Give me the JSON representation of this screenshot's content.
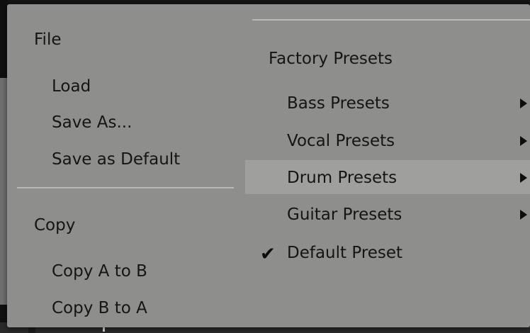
{
  "menu": {
    "left_column": {
      "file_header": "File",
      "file_items": [
        "Load",
        "Save As...",
        "Save as Default"
      ],
      "copy_header": "Copy",
      "copy_items": [
        "Copy A to B",
        "Copy B to A"
      ]
    },
    "right_column": {
      "factory_header": "Factory Presets",
      "presets": [
        {
          "label": "Bass Presets",
          "has_submenu": true
        },
        {
          "label": "Vocal Presets",
          "has_submenu": true
        },
        {
          "label": "Drum Presets",
          "has_submenu": true,
          "highlighted": true
        },
        {
          "label": "Guitar Presets",
          "has_submenu": true
        }
      ],
      "checked_item": {
        "label": "Default Preset",
        "checked": true,
        "check_glyph": "✔"
      }
    }
  },
  "colors": {
    "menu_background": "#8e8e8c",
    "highlight": "#9f9f9d",
    "separator": "#b9b9b7",
    "text": "#151515"
  },
  "icons": {
    "submenu": "submenu-arrow-icon",
    "checkmark": "checkmark-icon"
  }
}
